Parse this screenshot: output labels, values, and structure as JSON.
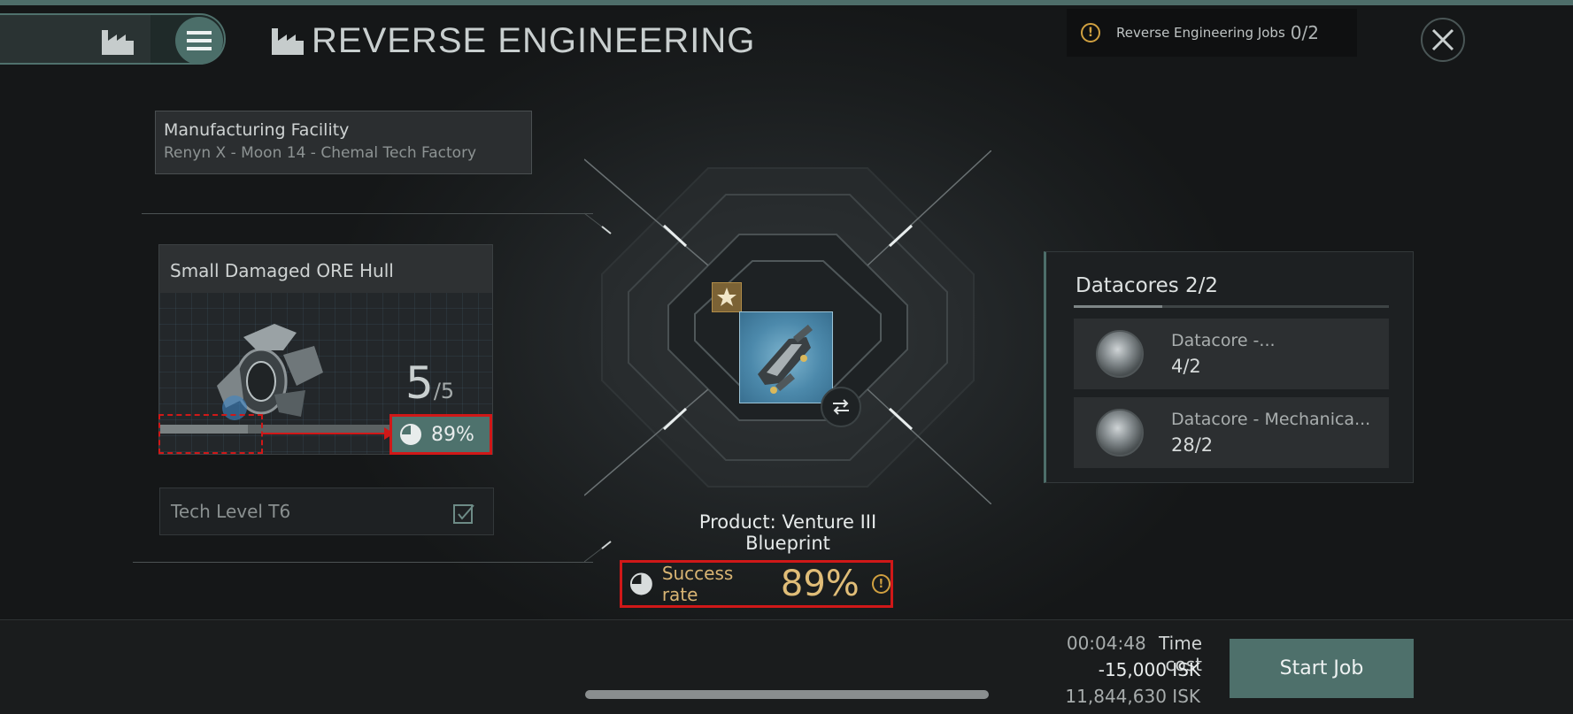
{
  "header": {
    "title": "REVERSE ENGINEERING",
    "jobs_label": "Reverse Engineering Jobs",
    "jobs_count": "0/2"
  },
  "facility": {
    "label": "Manufacturing Facility",
    "location": "Renyn X - Moon 14 - Chemal Tech Factory"
  },
  "hull": {
    "name": "Small Damaged ORE Hull",
    "have": "5",
    "need": "/5",
    "rate": "89%",
    "progress_fraction": 0.38
  },
  "tech": {
    "label": "Tech Level T6"
  },
  "product": {
    "label": "Product: Venture III Blueprint"
  },
  "success": {
    "label": "Success rate",
    "value": "89%"
  },
  "datacores": {
    "title": "Datacores 2/2",
    "items": [
      {
        "name": "Datacore -...",
        "qty": "4/2"
      },
      {
        "name": "Datacore - Mechanica...",
        "qty": "28/2"
      }
    ]
  },
  "cost": {
    "time": "00:04:48",
    "time_label": "Time cost",
    "isk_cost": "-15,000 ISK",
    "isk_balance": "11,844,630 ISK"
  },
  "actions": {
    "start_label": "Start Job"
  },
  "colors": {
    "accent": "#4e706b",
    "highlight_red": "#d01818",
    "gold": "#e0bd78"
  }
}
